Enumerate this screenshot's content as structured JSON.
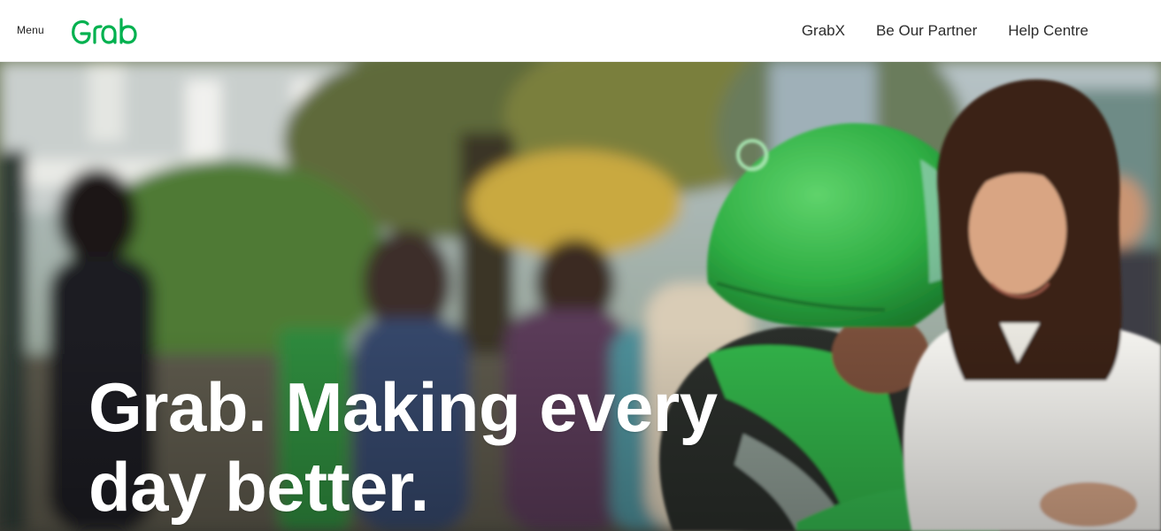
{
  "header": {
    "menu_label": "Menu",
    "logo_text": "Grab",
    "brand_color": "#00b14f",
    "nav": [
      {
        "label": "GrabX"
      },
      {
        "label": "Be Our Partner"
      },
      {
        "label": "Help Centre"
      }
    ]
  },
  "hero": {
    "headline": "Grab. Making every day better.",
    "image_subject": "grab-driver-with-green-helmet-and-customer-photo"
  }
}
